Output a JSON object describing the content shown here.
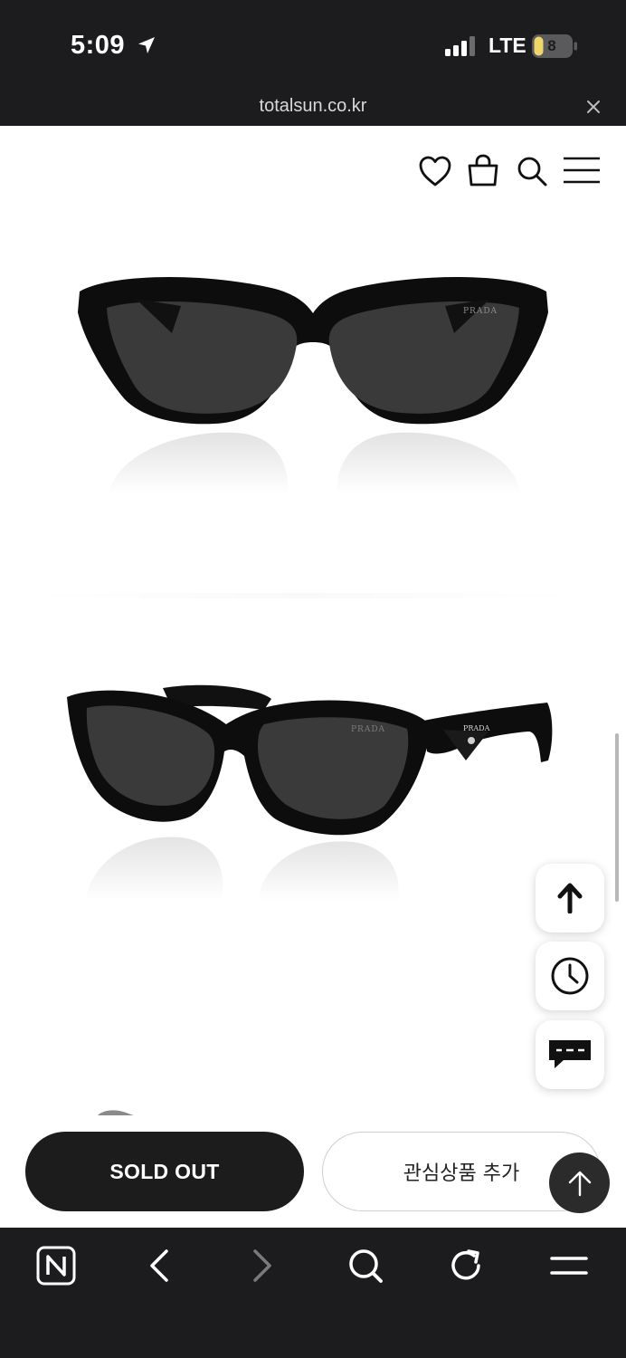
{
  "status_bar": {
    "time": "5:09",
    "network": "LTE",
    "battery": "8",
    "icons": [
      "location-arrow-icon",
      "signal-icon",
      "battery-icon"
    ]
  },
  "url_bar": {
    "url": "totalsun.co.kr",
    "close_icon": "close-icon"
  },
  "header": {
    "icons": [
      "heart-icon",
      "shopping-bag-icon",
      "search-icon",
      "menu-icon"
    ]
  },
  "product": {
    "brand_mark": "PRADA",
    "images": [
      "front-view",
      "side-angle-view"
    ]
  },
  "floating_buttons": [
    "arrow-up-icon",
    "clock-icon",
    "chat-icon"
  ],
  "actions": {
    "sold_out_label": "SOLD OUT",
    "wishlist_label": "관심상품 추가",
    "scroll_top_icon": "arrow-up-icon"
  },
  "browser_toolbar": {
    "icons": [
      "naver-icon",
      "back-icon",
      "forward-icon",
      "search-icon",
      "reload-icon",
      "menu-icon"
    ]
  },
  "colors": {
    "dark_bar": "#1c1c1e",
    "button_dark": "#1c1c1c",
    "battery_fill": "#f0d66a",
    "lens": "#3a3a3a"
  }
}
